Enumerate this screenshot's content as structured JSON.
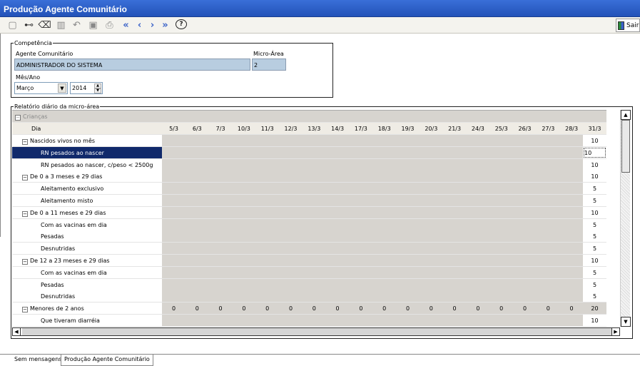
{
  "window": {
    "title": "Produção Agente Comunitário"
  },
  "toolbar": {
    "icons": [
      "new-icon",
      "search-binoculars-icon",
      "eraser-icon",
      "trash-icon",
      "undo-icon",
      "save-icon",
      "print-icon",
      "first-icon",
      "prev-icon",
      "next-icon",
      "last-icon",
      "help-icon"
    ],
    "help_label": "?",
    "exit_label": "Sair"
  },
  "competencia": {
    "legend": "Competência",
    "agent_label": "Agente Comunitário",
    "agent_value": "ADMINISTRADOR DO SISTEMA",
    "microarea_label": "Micro-Área",
    "microarea_value": "2",
    "month_year_label": "Mês/Ano",
    "month_value": "Março",
    "year_value": "2014"
  },
  "report": {
    "legend": "Relatório diário da micro-área",
    "group_label": "Crianças",
    "day_header": "Dia",
    "days": [
      "5/3",
      "6/3",
      "7/3",
      "10/3",
      "11/3",
      "12/3",
      "13/3",
      "14/3",
      "17/3",
      "18/3",
      "19/3",
      "20/3",
      "21/3",
      "24/3",
      "25/3",
      "26/3",
      "27/3",
      "28/3"
    ],
    "last_day": "31/3",
    "rows": [
      {
        "label": "Nascidos vivos no mês",
        "level": 1,
        "value": "10"
      },
      {
        "label": "RN pesados ao nascer",
        "level": 2,
        "value": "10",
        "selected": true
      },
      {
        "label": "RN pesados ao nascer, c/peso < 2500g",
        "level": 2,
        "value": "10"
      },
      {
        "label": "De 0 a 3 meses e 29 dias",
        "level": 1,
        "value": "10"
      },
      {
        "label": "Aleitamento exclusivo",
        "level": 2,
        "value": "5"
      },
      {
        "label": "Aleitamento misto",
        "level": 2,
        "value": "5"
      },
      {
        "label": "De 0 a 11 meses e 29 dias",
        "level": 1,
        "value": "10"
      },
      {
        "label": "Com as vacinas em dia",
        "level": 2,
        "value": "5"
      },
      {
        "label": "Pesadas",
        "level": 2,
        "value": "5"
      },
      {
        "label": "Desnutridas",
        "level": 2,
        "value": "5"
      },
      {
        "label": "De 12 a 23 meses e 29 dias",
        "level": 1,
        "value": "10"
      },
      {
        "label": "Com as vacinas em dia",
        "level": 2,
        "value": "5"
      },
      {
        "label": "Pesadas",
        "level": 2,
        "value": "5"
      },
      {
        "label": "Desnutridas",
        "level": 2,
        "value": "5"
      },
      {
        "label": "Menores de 2 anos",
        "level": 1,
        "value": "20",
        "daily": [
          "0",
          "0",
          "0",
          "0",
          "0",
          "0",
          "0",
          "0",
          "0",
          "0",
          "0",
          "0",
          "0",
          "0",
          "0",
          "0",
          "0",
          "0"
        ]
      },
      {
        "label": "Que tiveram diarréia",
        "level": 2,
        "value": "10"
      }
    ]
  },
  "tabs": [
    {
      "label": "Sem mensagens",
      "active": false
    },
    {
      "label": "Produção Agente Comunitário",
      "active": true
    }
  ]
}
